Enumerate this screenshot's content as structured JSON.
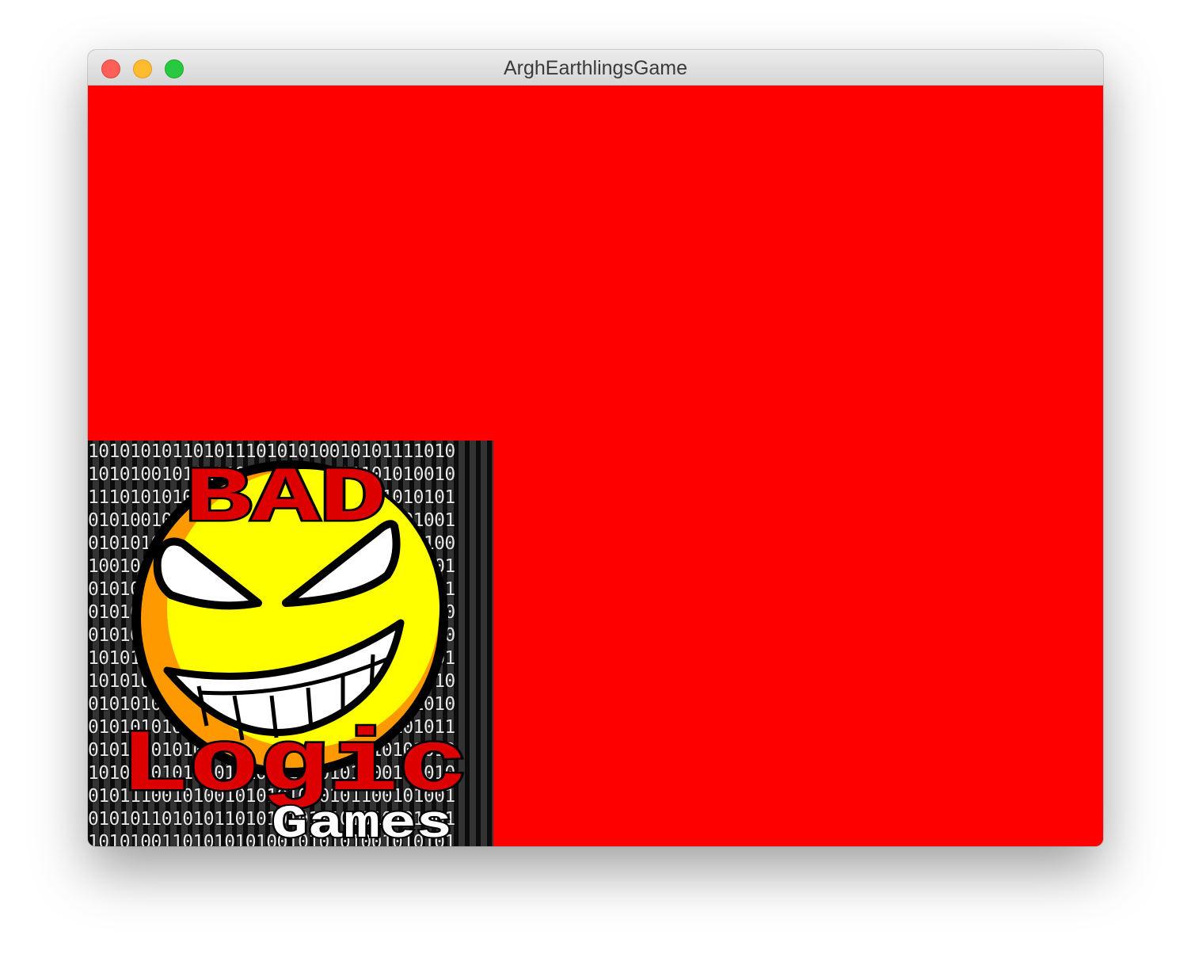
{
  "window": {
    "title": "ArghEarthlingsGame"
  },
  "canvas": {
    "background_color": "#ff0000"
  },
  "logo": {
    "word_top": "BAD",
    "word_middle": "Logic",
    "word_bottom": "Games",
    "binary_rows": [
      "10101010110101110101010010101111010",
      "10101001010101010101010101101010010",
      "11101010101010101010101010101010101",
      "01010010101010101010101010100101001",
      "01010101010101010101010101010101100",
      "10010101010101010101010101010101001",
      "01010101010101010101010101010101001",
      "01010101010101010101010101010101010",
      "01010101010101010101010101010101010",
      "10101010101010101010101010101010101",
      "10101010101010101010101010101001010",
      "01010101010101010101010101010101010",
      "01010101010101010101010101010101011",
      "01011101010101010101010101010101010",
      "10101001010101010101010101100101010",
      "01011100101001010101010101100101001",
      "01010110101011010101010101010101001",
      "10101001101010101001010101001010101"
    ],
    "colors": {
      "face": "#ffff00",
      "shade": "#ff9900",
      "text_red": "#dd0000",
      "outline": "#000000"
    }
  }
}
